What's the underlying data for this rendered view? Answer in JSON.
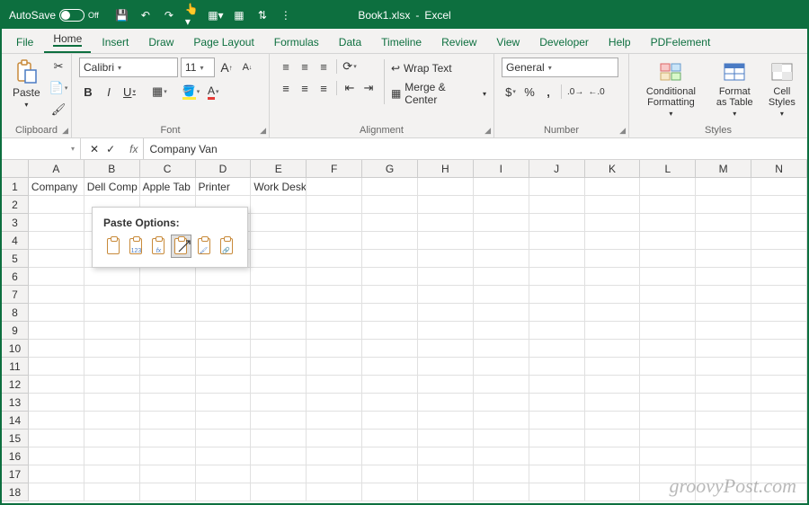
{
  "title": {
    "autosave": "AutoSave",
    "autosave_state": "Off",
    "filename": "Book1.xlsx",
    "app": "Excel",
    "sep": "-"
  },
  "qat": [
    "save",
    "undo",
    "redo",
    "touch",
    "new",
    "grid",
    "sort"
  ],
  "tabs": [
    "File",
    "Home",
    "Insert",
    "Draw",
    "Page Layout",
    "Formulas",
    "Data",
    "Timeline",
    "Review",
    "View",
    "Developer",
    "Help",
    "PDFelement"
  ],
  "active_tab": "Home",
  "clipboard": {
    "paste": "Paste",
    "label": "Clipboard"
  },
  "font": {
    "name": "Calibri",
    "size": "11",
    "label": "Font",
    "bold": "B",
    "italic": "I",
    "underline": "U",
    "increase": "A",
    "decrease": "A"
  },
  "alignment": {
    "label": "Alignment",
    "wrap": "Wrap Text",
    "merge": "Merge & Center"
  },
  "number": {
    "label": "Number",
    "format": "General",
    "currency": "$",
    "percent": "%",
    "comma": ","
  },
  "styles": {
    "label": "Styles",
    "cond": "Conditional Formatting",
    "table": "Format as Table",
    "cell": "Cell Styles"
  },
  "namebox": "",
  "formula": "Company Van",
  "fx": "fx",
  "columns": [
    "A",
    "B",
    "C",
    "D",
    "E",
    "F",
    "G",
    "H",
    "I",
    "J",
    "K",
    "L",
    "M",
    "N"
  ],
  "row_count": 18,
  "cells": {
    "A1": "Company",
    "B1": "Dell Comp",
    "C1": "Apple Tab",
    "D1": "Printer",
    "E1": "Work Desk"
  },
  "paste_popup": {
    "title": "Paste Options:",
    "options": [
      "paste",
      "values",
      "formulas",
      "transpose",
      "formatting",
      "link"
    ]
  },
  "watermark": "groovyPost.com"
}
